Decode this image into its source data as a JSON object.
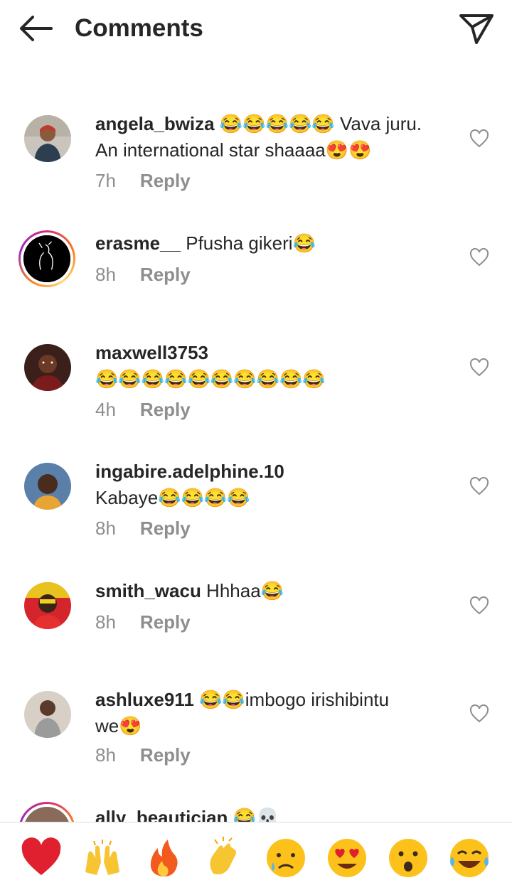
{
  "header": {
    "title": "Comments",
    "back_icon": "arrow-left-icon",
    "send_icon": "paper-plane-icon"
  },
  "comments": [
    {
      "username": "angela_bwiza",
      "text_before": " ",
      "text_after": " Vava juru.",
      "line2": "An international star shaaaa",
      "time": "7h",
      "reply": "Reply",
      "emojis": "😂😂😂😂😂",
      "emojis_end": "😍😍",
      "ring": false
    },
    {
      "username": "erasme__",
      "text_before": " Pfusha gikeri",
      "time": "8h",
      "reply": "Reply",
      "emojis": "😂",
      "ring": true
    },
    {
      "username": "maxwell3753",
      "time": "4h",
      "reply": "Reply",
      "emojis": "😂😂😂😂😂😂😂😂😂😂",
      "ring": false
    },
    {
      "username": "ingabire.adelphine.10",
      "text": "Kabaye",
      "time": "8h",
      "reply": "Reply",
      "emojis": "😂😂😂😂",
      "ring": false
    },
    {
      "username": "smith_wacu",
      "text_before": " Hhhaa",
      "time": "8h",
      "reply": "Reply",
      "emojis": "😂",
      "ring": false
    },
    {
      "username": "ashluxe911",
      "text_after": "imbogo irishibintu",
      "line2": "we",
      "time": "8h",
      "reply": "Reply",
      "emojis": "😂😂",
      "emojis_end": "😍",
      "ring": false
    },
    {
      "username": "ally_beautician",
      "emojis": "😂💀",
      "ring": true
    }
  ],
  "reactions": [
    "❤️",
    "🙌",
    "🔥",
    "👏",
    "😢",
    "😍",
    "😮",
    "😂"
  ],
  "colors": {
    "text": "#262626",
    "secondary": "#8e8e8e",
    "divider": "#dbdbdb"
  }
}
